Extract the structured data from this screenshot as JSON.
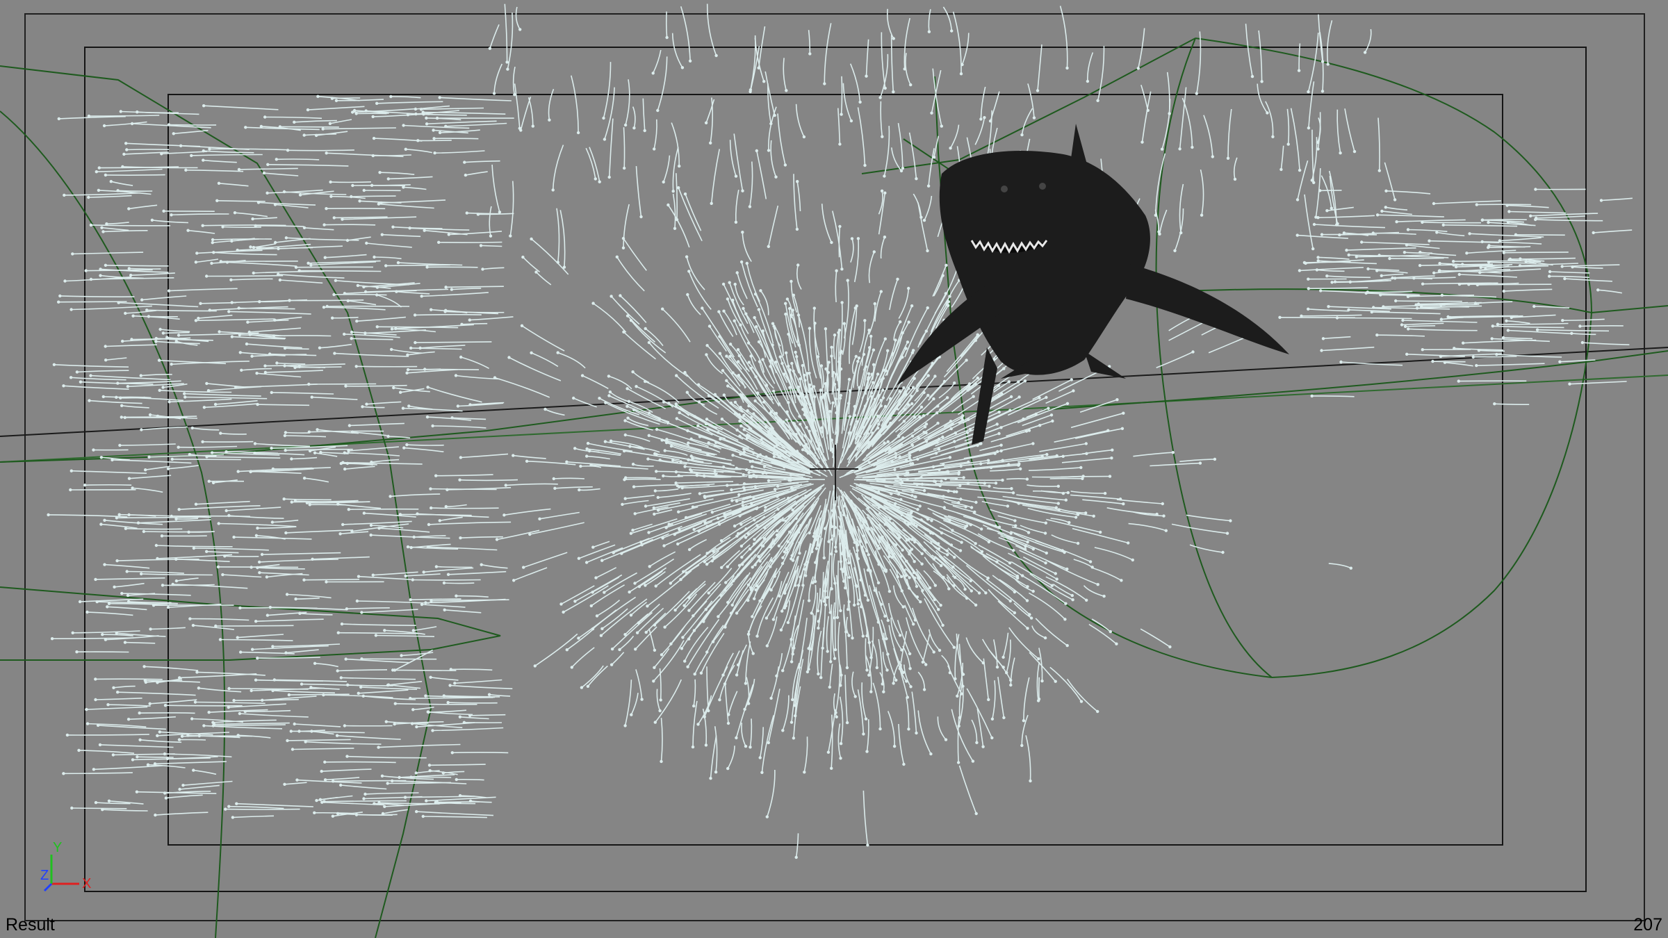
{
  "viewport": {
    "view_name": "Result",
    "frame_number": "207",
    "background_color": "#858585",
    "safe_frame_color": "#000000",
    "wireframe_color": "#1e5a1e",
    "particle_color": "#dcecec",
    "shark_color": "#1c1c1c"
  },
  "axis_gizmo": {
    "y_label": "Y",
    "z_label": "Z",
    "x_label": "X",
    "y_color": "#20c020",
    "z_color": "#2040ff",
    "x_color": "#e02020"
  },
  "icons": [
    "pivot-crosshair-icon",
    "axis-gizmo-icon"
  ]
}
